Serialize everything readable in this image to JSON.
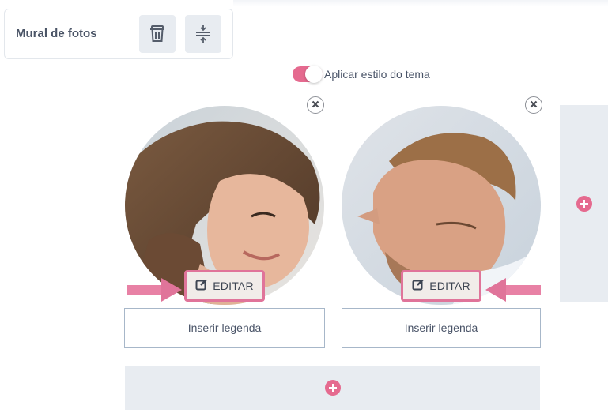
{
  "widget": {
    "title": "Mural de fotos",
    "tools": [
      {
        "icon": "trash-icon"
      },
      {
        "icon": "align-center-icon"
      }
    ]
  },
  "theme_toggle": {
    "label": "Aplicar estilo do tema",
    "on": true
  },
  "photos": [
    {
      "edit_label": "EDITAR",
      "caption_placeholder": "Inserir legenda",
      "edit_icon": "edit-icon",
      "remove_icon": "close-icon"
    },
    {
      "edit_label": "EDITAR",
      "caption_placeholder": "Inserir legenda",
      "edit_icon": "edit-icon",
      "remove_icon": "close-icon"
    }
  ],
  "add_buttons": {
    "icon": "plus-icon"
  },
  "colors": {
    "accent": "#e56a8f",
    "highlight": "#e0749a",
    "panel": "#e8ecf1"
  }
}
